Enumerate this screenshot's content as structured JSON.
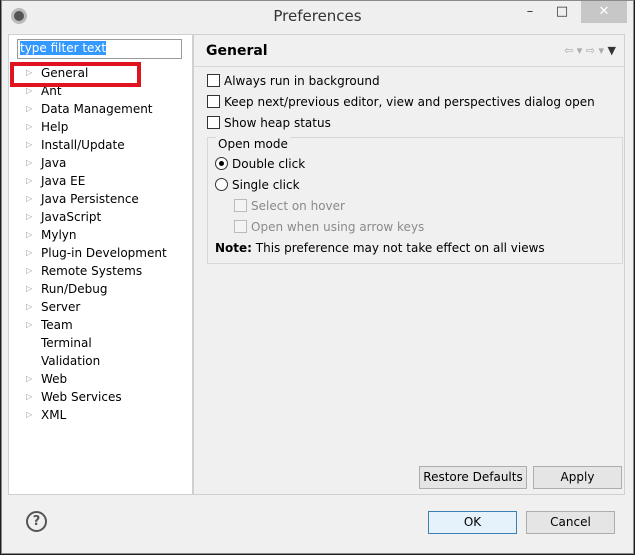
{
  "window": {
    "title": "Preferences",
    "minimize": "–",
    "maximize": "□",
    "close": "✕"
  },
  "filter": {
    "value": "type filter text"
  },
  "tree": [
    {
      "label": "General",
      "expandable": true
    },
    {
      "label": "Ant",
      "expandable": true
    },
    {
      "label": "Data Management",
      "expandable": true
    },
    {
      "label": "Help",
      "expandable": true
    },
    {
      "label": "Install/Update",
      "expandable": true
    },
    {
      "label": "Java",
      "expandable": true
    },
    {
      "label": "Java EE",
      "expandable": true
    },
    {
      "label": "Java Persistence",
      "expandable": true
    },
    {
      "label": "JavaScript",
      "expandable": true
    },
    {
      "label": "Mylyn",
      "expandable": true
    },
    {
      "label": "Plug-in Development",
      "expandable": true
    },
    {
      "label": "Remote Systems",
      "expandable": true
    },
    {
      "label": "Run/Debug",
      "expandable": true
    },
    {
      "label": "Server",
      "expandable": true
    },
    {
      "label": "Team",
      "expandable": true
    },
    {
      "label": "Terminal",
      "expandable": false
    },
    {
      "label": "Validation",
      "expandable": false
    },
    {
      "label": "Web",
      "expandable": true
    },
    {
      "label": "Web Services",
      "expandable": true
    },
    {
      "label": "XML",
      "expandable": true
    }
  ],
  "page": {
    "title": "General",
    "options": [
      {
        "label": "Always run in background",
        "checked": false
      },
      {
        "label": "Keep next/previous editor, view and perspectives dialog open",
        "checked": false
      },
      {
        "label": "Show heap status",
        "checked": false
      }
    ],
    "open_mode": {
      "title": "Open mode",
      "double": "Double click",
      "single": "Single click",
      "selected": "Double click",
      "hover": "Select on hover",
      "arrow": "Open when using arrow keys"
    },
    "note_label": "Note:",
    "note_text": " This preference may not take effect on all views"
  },
  "buttons": {
    "restore": "Restore Defaults",
    "apply": "Apply",
    "ok": "OK",
    "cancel": "Cancel",
    "help": "?"
  },
  "colors": {
    "highlight": "#e0141e",
    "selection": "#3399ff"
  }
}
